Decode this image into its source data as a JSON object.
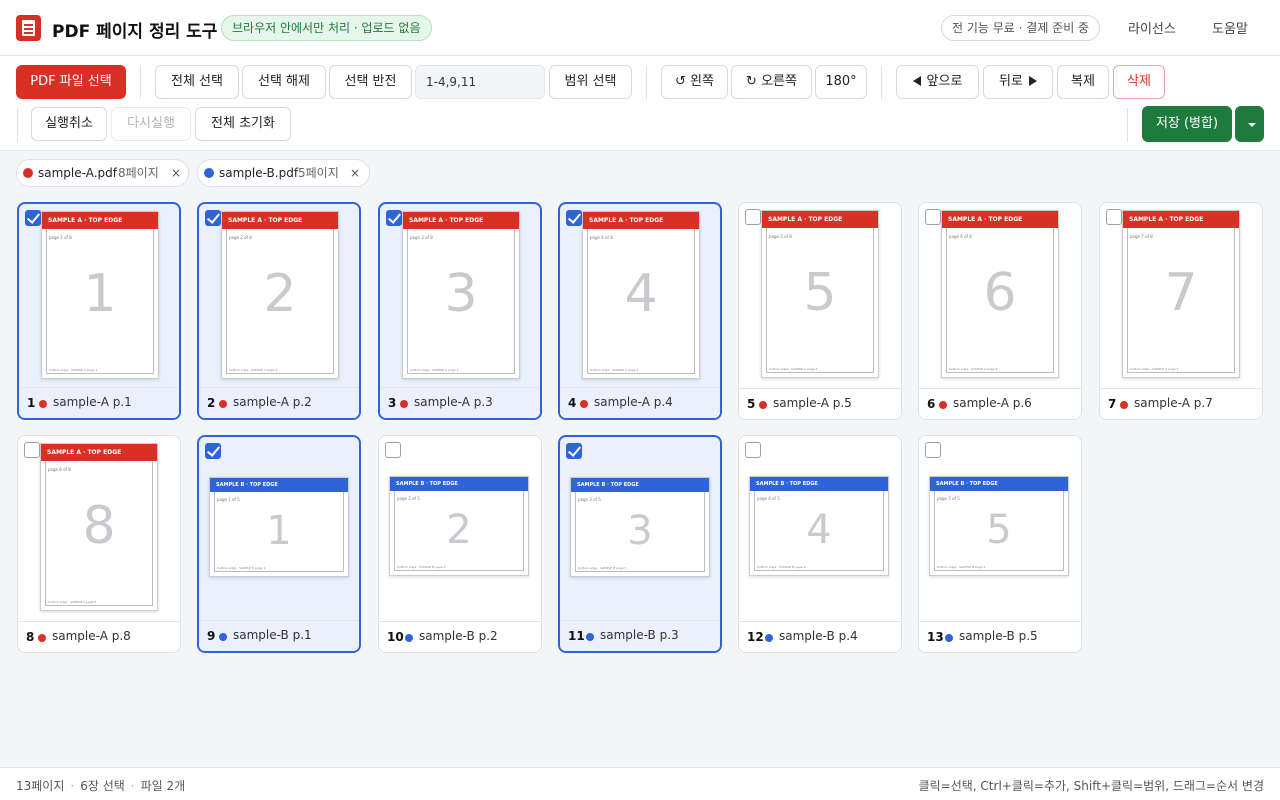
{
  "header": {
    "title": "PDF 페이지 정리 도구",
    "privacy_badge": "브라우저 안에서만 처리 · 업로드 없음",
    "free_badge": "전 기능 무료 · 결제 준비 중",
    "nav": [
      "라이선스",
      "도움말"
    ]
  },
  "toolbar": {
    "select_pdf": "PDF 파일 선택",
    "select_all": "전체 선택",
    "deselect": "선택 해제",
    "invert": "선택 반전",
    "range_value": "1-4,9,11",
    "range_select": "범위 선택",
    "rotate_left": "↺ 왼쪽",
    "rotate_right": "↻ 오른쪽",
    "rotate_180": "180°",
    "move_forward": "앞으로",
    "move_back": "뒤로",
    "duplicate": "복제",
    "delete": "삭제",
    "undo": "실행취소",
    "redo": "다시실행",
    "reset_all": "전체 초기화",
    "save": "저장 (병합)"
  },
  "colors": {
    "file_a": "#d93025",
    "file_b": "#2f64d8",
    "accent": "#2f64d8",
    "save": "#1f7a3d"
  },
  "files": [
    {
      "name": "sample-A.pdf",
      "pages": "8페이지"
    },
    {
      "name": "sample-B.pdf",
      "pages": "5페이지"
    }
  ],
  "pages": [
    {
      "num": "1",
      "label": "sample-A p.1",
      "file": "a",
      "selected": true,
      "band": "SAMPLE A · TOP EDGE",
      "page_of": "page 1 of 8",
      "big": "1",
      "foot": "bottom edge · SAMPLE A page 1"
    },
    {
      "num": "2",
      "label": "sample-A p.2",
      "file": "a",
      "selected": true,
      "band": "SAMPLE A · TOP EDGE",
      "page_of": "page 2 of 8",
      "big": "2",
      "foot": "bottom edge · SAMPLE A page 2"
    },
    {
      "num": "3",
      "label": "sample-A p.3",
      "file": "a",
      "selected": true,
      "band": "SAMPLE A · TOP EDGE",
      "page_of": "page 3 of 8",
      "big": "3",
      "foot": "bottom edge · SAMPLE A page 3"
    },
    {
      "num": "4",
      "label": "sample-A p.4",
      "file": "a",
      "selected": true,
      "band": "SAMPLE A · TOP EDGE",
      "page_of": "page 4 of 8",
      "big": "4",
      "foot": "bottom edge · SAMPLE A page 4"
    },
    {
      "num": "5",
      "label": "sample-A p.5",
      "file": "a",
      "selected": false,
      "band": "SAMPLE A · TOP EDGE",
      "page_of": "page 5 of 8",
      "big": "5",
      "foot": "bottom edge · SAMPLE A page 5"
    },
    {
      "num": "6",
      "label": "sample-A p.6",
      "file": "a",
      "selected": false,
      "band": "SAMPLE A · TOP EDGE",
      "page_of": "page 6 of 8",
      "big": "6",
      "foot": "bottom edge · SAMPLE A page 6"
    },
    {
      "num": "7",
      "label": "sample-A p.7",
      "file": "a",
      "selected": false,
      "band": "SAMPLE A · TOP EDGE",
      "page_of": "page 7 of 8",
      "big": "7",
      "foot": "bottom edge · SAMPLE A page 7"
    },
    {
      "num": "8",
      "label": "sample-A p.8",
      "file": "a",
      "selected": false,
      "band": "SAMPLE A · TOP EDGE",
      "page_of": "page 8 of 8",
      "big": "8",
      "foot": "bottom edge · SAMPLE A page 8"
    },
    {
      "num": "9",
      "label": "sample-B p.1",
      "file": "b",
      "selected": true,
      "band": "SAMPLE B · TOP EDGE",
      "page_of": "page 1 of 5",
      "big": "1",
      "foot": "bottom edge · SAMPLE B page 1"
    },
    {
      "num": "10",
      "label": "sample-B p.2",
      "file": "b",
      "selected": false,
      "band": "SAMPLE B · TOP EDGE",
      "page_of": "page 2 of 5",
      "big": "2",
      "foot": "bottom edge · SAMPLE B page 2"
    },
    {
      "num": "11",
      "label": "sample-B p.3",
      "file": "b",
      "selected": true,
      "band": "SAMPLE B · TOP EDGE",
      "page_of": "page 3 of 5",
      "big": "3",
      "foot": "bottom edge · SAMPLE B page 3"
    },
    {
      "num": "12",
      "label": "sample-B p.4",
      "file": "b",
      "selected": false,
      "band": "SAMPLE B · TOP EDGE",
      "page_of": "page 4 of 5",
      "big": "4",
      "foot": "bottom edge · SAMPLE B page 4"
    },
    {
      "num": "13",
      "label": "sample-B p.5",
      "file": "b",
      "selected": false,
      "band": "SAMPLE B · TOP EDGE",
      "page_of": "page 5 of 5",
      "big": "5",
      "foot": "bottom edge · SAMPLE B page 5"
    }
  ],
  "status": {
    "pages": "13페이지",
    "selected": "6장 선택",
    "files": "파일 2개",
    "hint": "클릭=선택, Ctrl+클릭=추가, Shift+클릭=범위, 드래그=순서 변경"
  }
}
